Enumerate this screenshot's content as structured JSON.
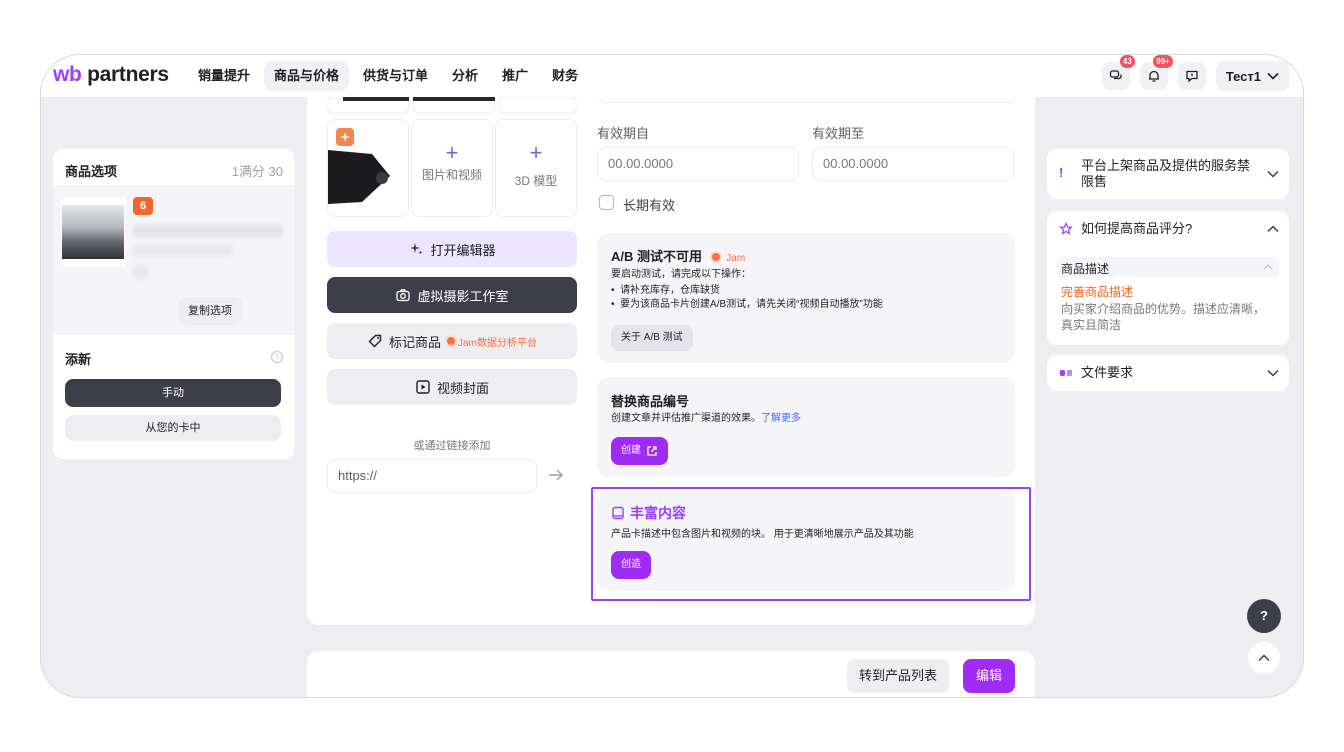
{
  "brand": {
    "logo_prefix": "wb",
    "logo_suffix": "partners"
  },
  "nav": [
    "销量提升",
    "商品与价格",
    "供货与订单",
    "分析",
    "推广",
    "财务"
  ],
  "topbar": {
    "chat_badge": "43",
    "notif_badge": "99+",
    "user": "Тест1"
  },
  "left_panel": {
    "title": "商品选项",
    "count": "1满分 30",
    "badge": "6",
    "copy_button": "复制选项",
    "add_title": "添新",
    "info_icon": "i",
    "manual_button": "手动",
    "from_card_button": "从您的卡中"
  },
  "media": {
    "tile_photo_video": "图片和视频",
    "tile_3d": "3D 模型",
    "editor_button": "打开编辑器",
    "studio_button": "虚拟摄影工作室",
    "tag_button": "标记商品",
    "tag_jam": "Jam数据分析平台",
    "video_cover_button": "视频封面",
    "or_link": "或通过链接添加",
    "url_placeholder": "https://"
  },
  "validity": {
    "from_label": "有效期自",
    "to_label": "有效期至",
    "from_value": "00.00.0000",
    "to_value": "00.00.0000",
    "long_term_label": "长期有效"
  },
  "ab_test": {
    "title": "A/B 测试不可用",
    "jam": "Jam",
    "intro": "要启动测试，请完成以下操作：",
    "bullets": [
      "请补充库存，仓库缺货",
      "要为该商品卡片创建A/B测试，请先关闭“视频自动播放”功能"
    ],
    "button": "关于 A/B 测试"
  },
  "replace_code": {
    "title": "替换商品编号",
    "text": "创建文章并评估推广渠道的效果。",
    "link": "了解更多",
    "button": "创建"
  },
  "rich_content": {
    "title": "丰富内容",
    "text": "产品卡描述中包含图片和视频的块。 用于更清晰地展示产品及其功能",
    "button": "创造"
  },
  "bottom": {
    "to_list_button": "转到产品列表",
    "edit_button": "编辑"
  },
  "right_panel": {
    "banned_title": "平台上架商品及提供的服务禁限售",
    "banned_icon": "!",
    "rating_title": "如何提高商品评分?",
    "rating_sub": "商品描述",
    "rating_action": "完善商品描述",
    "rating_desc": "向买家介绍商品的优势。描述应清晰，真实且简洁",
    "file_title": "文件要求"
  },
  "help_button": "?",
  "colors": {
    "accent": "#a02bf5",
    "highlight": "#9a41fe",
    "orange": "#f26522",
    "dark_button": "#3e3e4a"
  }
}
